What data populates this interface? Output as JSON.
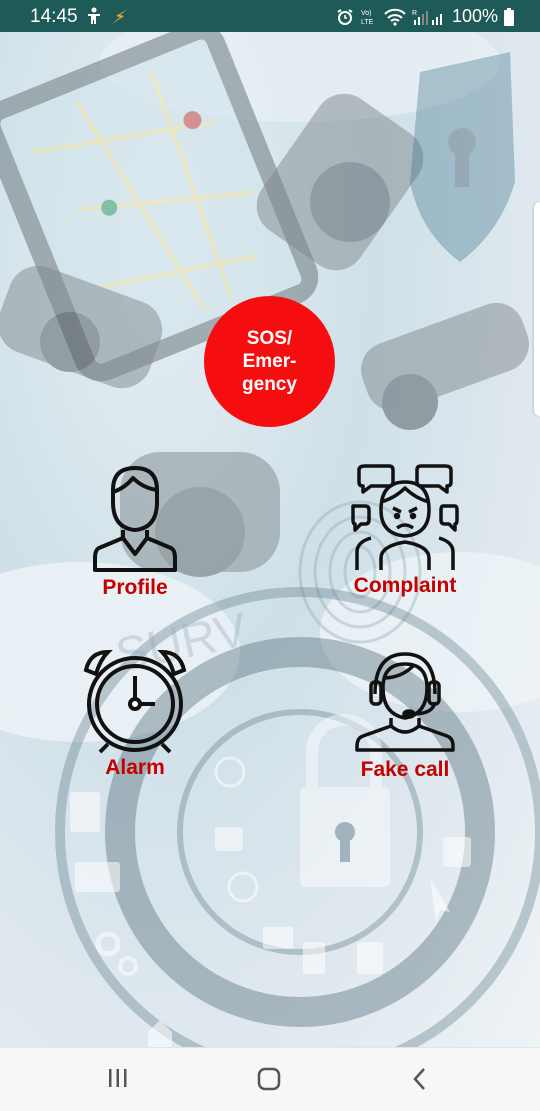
{
  "status_bar": {
    "time": "14:45",
    "battery": "100%",
    "icons_left": [
      "accessibility-icon",
      "flash-icon"
    ],
    "icons_right": [
      "alarm-icon",
      "volte-icon",
      "wifi-icon",
      "signal-icon",
      "battery-icon"
    ]
  },
  "sos_button": {
    "label": "SOS/\nEmer-\ngency",
    "color": "#f60d10"
  },
  "tiles": {
    "profile": {
      "label": "Profile",
      "icon": "person-icon"
    },
    "complaint": {
      "label": "Complaint",
      "icon": "crowd-complaint-icon"
    },
    "alarm": {
      "label": "Alarm",
      "icon": "alarm-clock-icon"
    },
    "fake_call": {
      "label": "Fake call",
      "icon": "headset-operator-icon"
    }
  },
  "label_color": "#c40000",
  "status_bar_color": "#1e5a57",
  "nav_bar": {
    "buttons": [
      "recent-apps-icon",
      "home-icon",
      "back-icon"
    ]
  }
}
